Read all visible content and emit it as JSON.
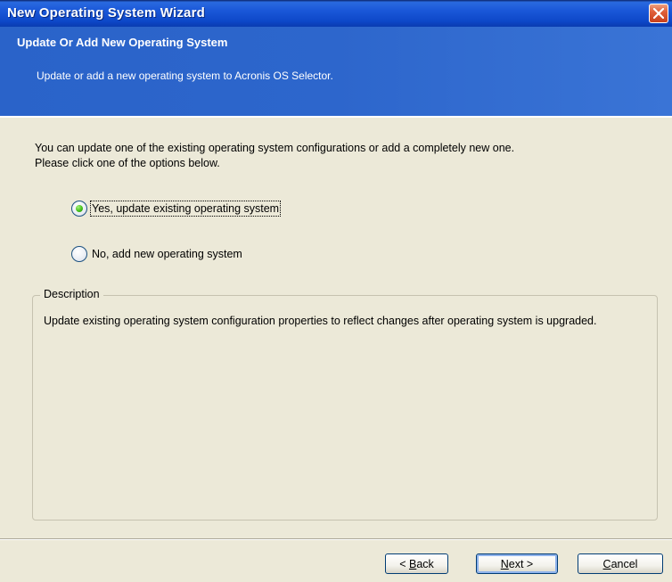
{
  "window": {
    "title": "New Operating System Wizard",
    "close_icon": "close-icon"
  },
  "header": {
    "title": "Update Or Add New Operating System",
    "subtitle": "Update or add a new operating system to Acronis OS Selector."
  },
  "body": {
    "intro_line1": "You can update one of the existing operating system configurations or add a completely new one.",
    "intro_line2": "Please click one of the options below.",
    "options": [
      {
        "label": "Yes, update existing operating system",
        "selected": true
      },
      {
        "label": "No, add new operating system",
        "selected": false
      }
    ]
  },
  "description": {
    "legend": "Description",
    "text": "Update existing operating system configuration properties to reflect changes after operating system is upgraded."
  },
  "buttons": {
    "back_mnemonic": "B",
    "back_rest": "ack",
    "back_prefix": "< ",
    "next_mnemonic": "N",
    "next_rest": "ext >",
    "cancel_mnemonic": "C",
    "cancel_rest": "ancel"
  },
  "colors": {
    "title_bar": "#1a57d8",
    "header_bg": "#2d66cc",
    "window_bg": "#ece9d8",
    "close_button": "#e0603a",
    "radio_dot": "#44c01c"
  }
}
